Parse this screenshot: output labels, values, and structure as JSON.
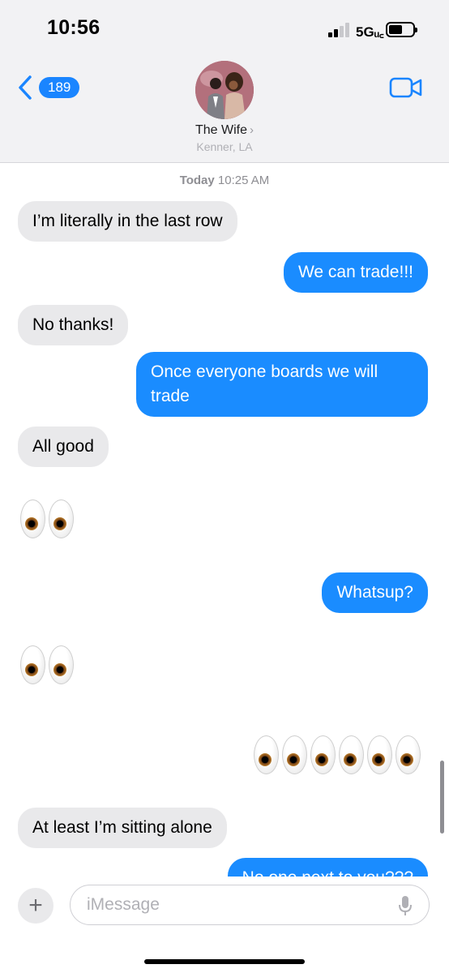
{
  "status_bar": {
    "time": "10:56",
    "network": "5GUC",
    "network_display": "5Gᵤ꜀"
  },
  "header": {
    "back_count": "189",
    "contact_name": "The Wife",
    "contact_location": "Kenner, LA"
  },
  "thread": {
    "timestamp_day": "Today",
    "timestamp_time": "10:25 AM",
    "messages": [
      {
        "from": "them",
        "text": "I’m literally in the last row"
      },
      {
        "from": "me",
        "text": "We can trade!!!"
      },
      {
        "from": "them",
        "text": "No thanks!"
      },
      {
        "from": "me",
        "text": "Once everyone boards we will trade"
      },
      {
        "from": "them",
        "text": "All good"
      },
      {
        "from": "them",
        "emoji": "👀",
        "count": 1
      },
      {
        "from": "me",
        "text": "Whatsup?"
      },
      {
        "from": "them",
        "emoji": "👀",
        "count": 1
      },
      {
        "from": "me",
        "emoji": "👀👀👀",
        "count": 3
      },
      {
        "from": "them",
        "text": "At least I’m sitting alone"
      },
      {
        "from": "me",
        "text": "No one next to you???"
      }
    ]
  },
  "composer": {
    "placeholder": "iMessage"
  },
  "colors": {
    "sent": "#1a8cff",
    "received": "#e9e9eb",
    "accent": "#1a85ff"
  },
  "icons": [
    "back-chevron-icon",
    "video-camera-icon",
    "plus-icon",
    "microphone-icon",
    "signal-icon",
    "battery-icon"
  ]
}
